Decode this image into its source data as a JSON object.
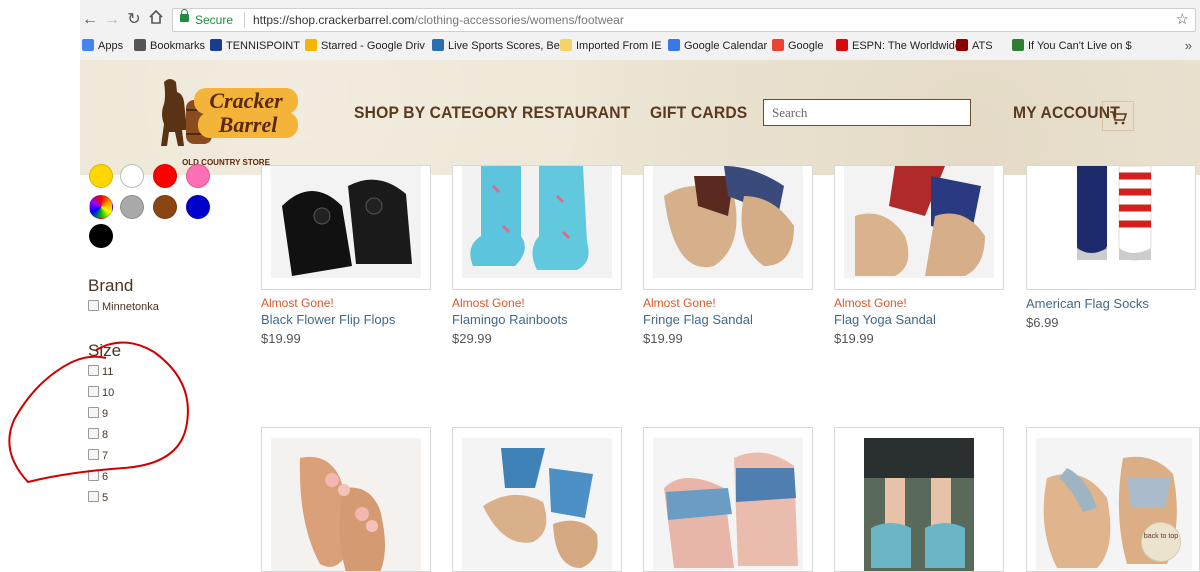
{
  "browser": {
    "secure_label": "Secure",
    "url_host": "https://shop.crackerbarrel.com",
    "url_path": "/clothing-accessories/womens/footwear",
    "bookmarks": [
      {
        "label": "Apps",
        "color": "#4285f4"
      },
      {
        "label": "Bookmarks",
        "color": "#555555"
      },
      {
        "label": "TENNISPOINT",
        "color": "#1a3c8c"
      },
      {
        "label": "Starred - Google Driv",
        "color": "#f4b400"
      },
      {
        "label": "Live Sports Scores, Be",
        "color": "#2a6fb0"
      },
      {
        "label": "Imported From IE",
        "color": "#f5d36b"
      },
      {
        "label": "Google Calendar",
        "color": "#3b78e7"
      },
      {
        "label": "Google",
        "color": "#ea4335"
      },
      {
        "label": "ESPN: The Worldwide",
        "color": "#d50a0a"
      },
      {
        "label": "ATS",
        "color": "#8b0000"
      },
      {
        "label": "If You Can't Live on $",
        "color": "#2e7d32"
      }
    ]
  },
  "header": {
    "brand_line1": "Cracker",
    "brand_line2": "Barrel",
    "brand_sub": "OLD COUNTRY STORE",
    "nav": [
      "SHOP BY CATEGORY",
      "RESTAURANT",
      "GIFT CARDS"
    ],
    "search_placeholder": "Search",
    "account_label": "MY ACCOUNT"
  },
  "filters": {
    "colors": [
      "#ffd700",
      "#ffffff",
      "#ff0000",
      "#ff6fb5",
      "multicolor",
      "#a9a9a9",
      "#8b4513",
      "#0000cd",
      "#000000"
    ],
    "brand_title": "Brand",
    "brands": [
      "Minnetonka"
    ],
    "size_title": "Size",
    "sizes": [
      "11",
      "10",
      "9",
      "8",
      "7",
      "6",
      "5"
    ]
  },
  "products_row1": [
    {
      "badge": "Almost Gone!",
      "name": "Black Flower Flip Flops",
      "price": "$19.99"
    },
    {
      "badge": "Almost Gone!",
      "name": "Flamingo Rainboots",
      "price": "$29.99"
    },
    {
      "badge": "Almost Gone!",
      "name": "Fringe Flag Sandal",
      "price": "$19.99"
    },
    {
      "badge": "Almost Gone!",
      "name": "Flag Yoga Sandal",
      "price": "$19.99"
    },
    {
      "badge": "",
      "name": "American Flag Socks",
      "price": "$6.99"
    }
  ],
  "back_to_top": "back to top",
  "annotation_color": "#d00000"
}
